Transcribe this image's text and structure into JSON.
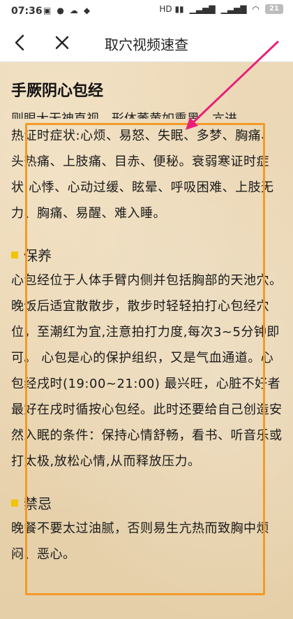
{
  "statusbar": {
    "time": "07:36",
    "battery": "21"
  },
  "nav": {
    "title": "取穴视频速查"
  },
  "page": {
    "heading": "手厥阴心包经",
    "partial_line": "则眼大无神直视，形体萎黄如熏黑。亢进",
    "symptoms": "热证时症状:心烦、易怒、失眠、多梦、胸痛、头热痛、上肢痛、目赤、便秘。衰弱寒证时症状:心悸、心动过缓、眩晕、呼吸困难、上肢无力、胸痛、易醒、难入睡。",
    "care_title": "保养",
    "care_text": "心包经位于人体手臂内侧并包括胸部的天池穴。晚饭后适宜散散步，散步时轻轻拍打心包经穴位，至潮红为宜,注意拍打力度,每次3~5分钟即可。 心包是心的保护组织，又是气血通道。心包经戌时(19:00~21:00) 最兴旺，心脏不好者最好在戌时循按心包经。此时还要给自己创造安然入眠的条件：保持心情舒畅，看书、听音乐或打太极,放松心情,从而释放压力。",
    "taboo_title": "禁忌",
    "taboo_text": "晚餐不要太过油腻，否则易生亢热而致胸中烦闷、恶心。"
  },
  "colors": {
    "annotation_box": "#f39a28",
    "annotation_arrow": "#e8207a",
    "section_marker": "#f2c400"
  }
}
